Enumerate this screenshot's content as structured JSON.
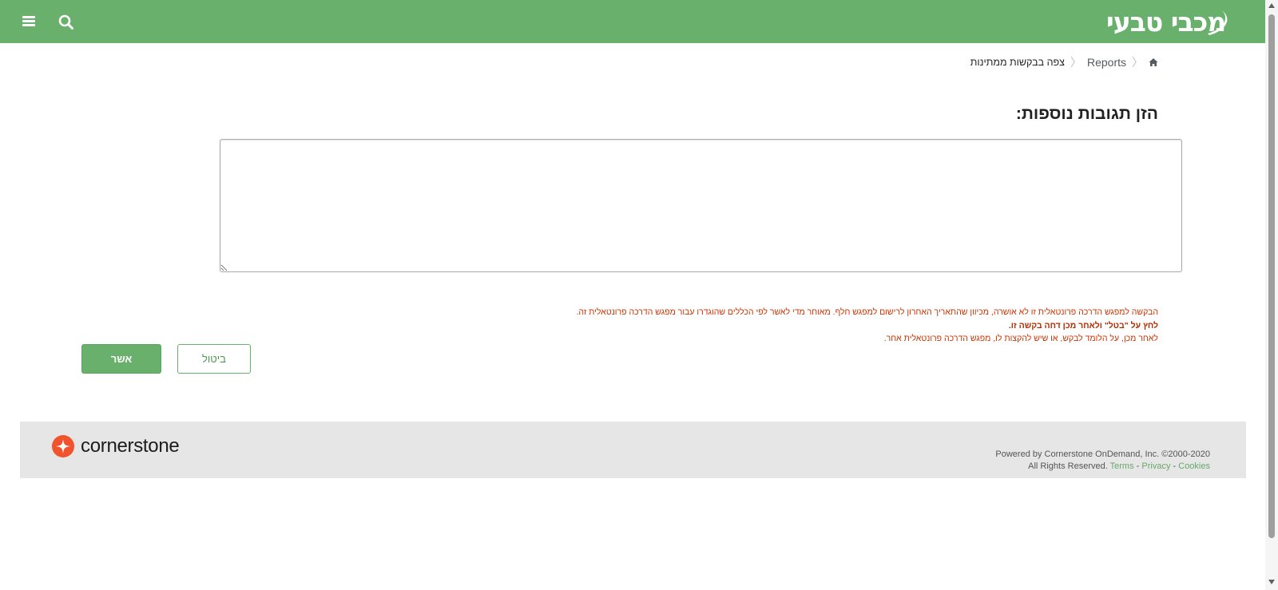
{
  "header": {
    "logo_text": "מכבי טבעי",
    "brand_color": "#69b06c",
    "menu_icon": "hamburger-menu-icon",
    "search_icon": "search-icon"
  },
  "breadcrumb": {
    "home_icon": "home-icon",
    "items": [
      "Reports",
      "צפה בבקשות ממתינות"
    ]
  },
  "form": {
    "title": "הזן תגובות נוספות:",
    "comments_value": ""
  },
  "warning": {
    "line1": "הבקשה למפגש הדרכה פרונטאלית זו לא אושרה, מכיוון שהתאריך האחרון לרישום למפגש חלף. מאוחר מדי לאשר לפי הכללים שהוגדרו עבור מפגש הדרכה פרונטאלית זה.",
    "line2": "לחץ על \"בטל\" ולאחר מכן דחה בקשה זו.",
    "line3": "לאחר מכן, על הלומד לבקש, או שיש להקצות לו, מפגש הדרכה פרונטאלית אחר.",
    "color": "#cc3300"
  },
  "buttons": {
    "confirm_label": "אשר",
    "cancel_label": "ביטול"
  },
  "footer": {
    "brand_name": "cornerstone",
    "powered_by": "Powered by Cornerstone OnDemand, Inc. ©2000-2020",
    "rights": "All Rights Reserved.",
    "terms": "Terms",
    "privacy": "Privacy",
    "cookies": "Cookies",
    "separator": "-",
    "brand_color": "#f0532d"
  }
}
